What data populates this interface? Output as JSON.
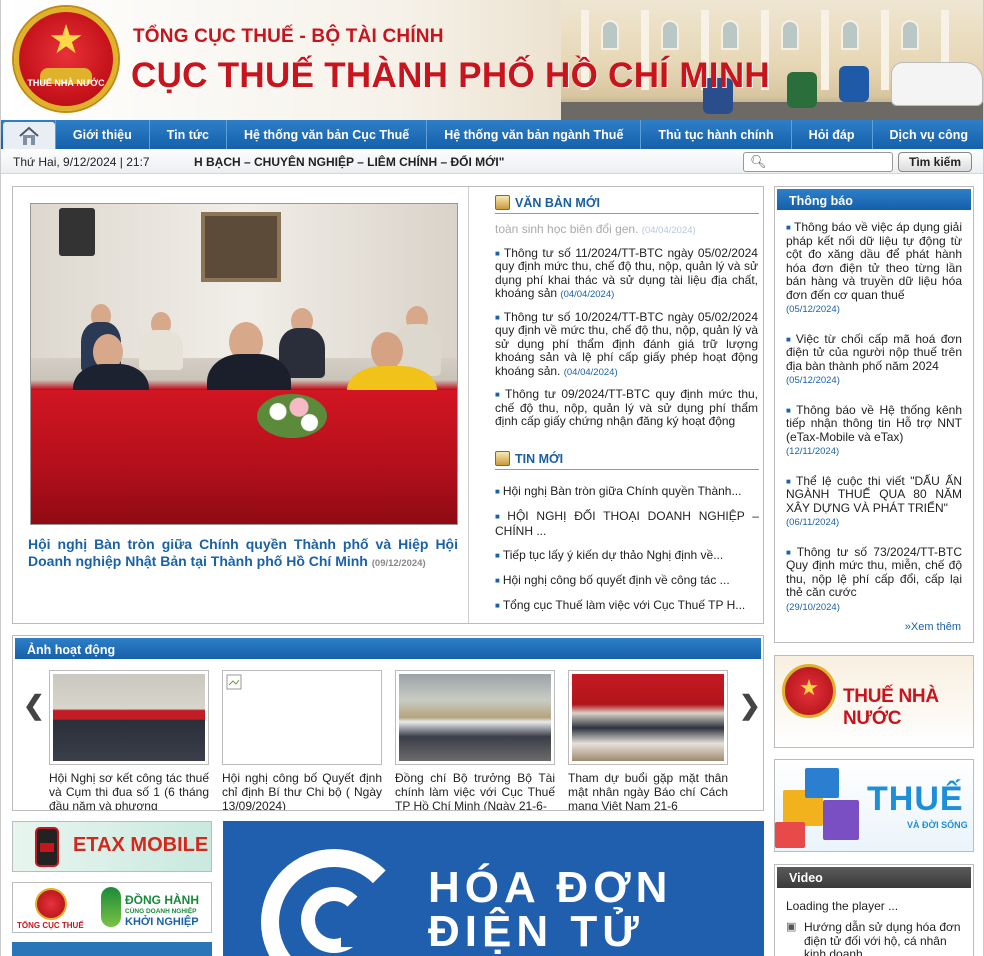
{
  "header": {
    "subtitle": "TỔNG CỤC THUẾ - BỘ TÀI CHÍNH",
    "title": "CỤC THUẾ THÀNH PHỐ HỒ CHÍ MINH",
    "emblem_text": "THUẾ NHÀ NƯỚC"
  },
  "nav": {
    "home_icon": "home-icon",
    "items": [
      "Giới thiệu",
      "Tin tức",
      "Hệ thống văn bản Cục Thuế",
      "Hệ thống văn bản ngành Thuế",
      "Thủ tục hành chính",
      "Hỏi đáp",
      "Dịch vụ công"
    ]
  },
  "infobar": {
    "date": "Thứ Hai, 9/12/2024 | 21:7",
    "slogan": "H BẠCH – CHUYÊN NGHIỆP – LIÊM CHÍNH – ĐỔI MỚI\"",
    "search_value": "",
    "search_button": "Tìm kiếm"
  },
  "featured": {
    "title": "Hội nghị Bàn tròn giữa Chính quyền Thành phố và Hiệp Hội Doanh nghiệp Nhật Bản tại Thành phố Hồ Chí Minh",
    "date": "(09/12/2024)"
  },
  "van_ban_moi": {
    "title": "VĂN BẢN MỚI",
    "faded": {
      "text": "toàn sinh học biên đổi gen.",
      "date": "(04/04/2024)"
    },
    "items": [
      {
        "text": "Thông tư số 11/2024/TT-BTC ngày 05/02/2024 quy định mức thu, chế độ thu, nộp, quản lý và sử dụng phí khai thác và sử dụng tài liệu địa chất, khoáng sản",
        "date": "(04/04/2024)"
      },
      {
        "text": "Thông tư số 10/2024/TT-BTC ngày 05/02/2024 quy định về mức thu, chế độ thu, nộp, quản lý và sử dụng phí thẩm định đánh giá trữ lượng khoáng sản và lệ phí cấp giấy phép hoạt động khoáng sản.",
        "date": "(04/04/2024)"
      },
      {
        "text": "Thông tư 09/2024/TT-BTC quy định mức thu, chế độ thu, nộp, quản lý và sử dụng phí thẩm định cấp giấy chứng nhận đăng ký hoạt động",
        "date": ""
      }
    ]
  },
  "tin_moi": {
    "title": "TIN MỚI",
    "items": [
      "Hội nghị Bàn tròn giữa Chính quyền Thành...",
      "HỘI NGHỊ ĐỐI THOẠI DOANH NGHIỆP – CHÍNH ...",
      "Tiếp tục lấy ý kiến dự thảo Nghị định về...",
      "Hội nghị công bố quyết định về công tác ...",
      "Tổng cục Thuế làm việc với Cục Thuế TP H..."
    ]
  },
  "thong_bao": {
    "title": "Thông báo",
    "items": [
      {
        "text": "Thông báo về việc áp dụng giải pháp kết nối dữ liệu tự động từ cột đo xăng dầu để phát hành hóa đơn điện tử theo từng lần bán hàng và truyền dữ liệu hóa đơn đến cơ quan thuế",
        "date": "(05/12/2024)"
      },
      {
        "text": "Việc từ chối cấp mã hoá đơn điện tử của người nộp thuế trên địa bàn thành phố năm 2024",
        "date": "(05/12/2024)"
      },
      {
        "text": "Thông báo về Hệ thống kênh tiếp nhận thông tin Hỗ trợ NNT (eTax-Mobile và eTax)",
        "date": "(12/11/2024)"
      },
      {
        "text": "Thể lệ cuộc thi viết \"DẤU ẤN NGÀNH THUẾ QUA 80 NĂM XÂY DỰNG VÀ PHÁT TRIỂN\"",
        "date": "(06/11/2024)"
      },
      {
        "text": "Thông tư số 73/2024/TT-BTC Quy định mức thu, miễn, chế độ thu, nộp lệ phí cấp đổi, cấp lại thẻ căn cước",
        "date": "(29/10/2024)"
      }
    ],
    "more": "Xem thêm"
  },
  "gallery": {
    "title": "Ảnh hoạt động",
    "prev_icon": "❮",
    "next_icon": "❯",
    "items": [
      {
        "caption": "Hội Nghị sơ kết công tác thuế và Cụm thi đua số 1 (6 tháng đầu năm và phương"
      },
      {
        "caption": "Hội nghị công bố Quyết định chỉ định Bí thư Chi bộ ( Ngày 13/09/2024)"
      },
      {
        "caption": "Đồng chí Bộ trưởng Bộ Tài chính làm việc với Cục Thuế TP Hồ Chí Minh (Ngày 21-6-"
      },
      {
        "caption": "Tham dự buổi gặp mặt thân mật nhân ngày Báo chí Cách mạng Việt Nam 21-6"
      }
    ]
  },
  "banners": {
    "thue_nha_nuoc": "THUẾ NHÀ NƯỚC",
    "ethue_main": "THUẾ",
    "ethue_sub": "VÀ ĐỜI SỐNG",
    "etax": "ETAX MOBILE",
    "dh_caption": "TỔNG CỤC THUẾ",
    "dh_line1": "ĐỒNG HÀNH",
    "dh_line2": "CÙNG DOANH NGHIỆP",
    "dh_line3": "KHỞI NGHIỆP",
    "hoadon_line1": "HÓA ĐƠN",
    "hoadon_line2": "ĐIỆN TỬ"
  },
  "video": {
    "title": "Video",
    "loading": "Loading the player ...",
    "item": "Hướng dẫn sử dụng hóa đơn điện tử đối với hộ, cá nhân kinh doanh"
  }
}
